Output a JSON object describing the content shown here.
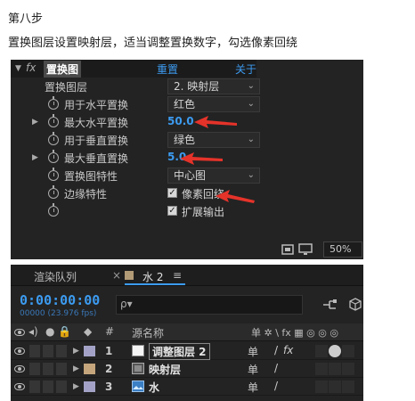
{
  "article": {
    "step_title": "第八步",
    "instruction": "置换图层设置映射层，适当调整置换数字，勾选像素回绕"
  },
  "effect_controls": {
    "effect": {
      "name": "置换图",
      "reset_label": "重置",
      "about_label": "关于"
    },
    "properties": [
      {
        "id": "map_layer",
        "label": "置换图层",
        "control": "dropdown",
        "value": "2. 映射层"
      },
      {
        "id": "use_horizontal",
        "label": "用于水平置换",
        "control": "dropdown",
        "value": "红色"
      },
      {
        "id": "max_horizontal",
        "label": "最大水平置换",
        "control": "number",
        "value": "50.0"
      },
      {
        "id": "use_vertical",
        "label": "用于垂直置换",
        "control": "dropdown",
        "value": "绿色"
      },
      {
        "id": "max_vertical",
        "label": "最大垂直置换",
        "control": "number",
        "value": "5.0"
      },
      {
        "id": "map_behavior",
        "label": "置换图特性",
        "control": "dropdown",
        "value": "中心图"
      },
      {
        "id": "edge_behavior",
        "label": "边缘特性",
        "control": "checkbox",
        "value": "像素回绕",
        "checked": true
      },
      {
        "id": "expand_output",
        "label": "",
        "control": "checkbox",
        "value": "扩展输出",
        "checked": true
      }
    ],
    "zoom": "50%"
  },
  "timeline": {
    "tabs": {
      "render_queue": "渲染队列",
      "comp_close": "×",
      "comp_name": "水 2",
      "menu": "≡"
    },
    "timecode": "0:00:00:00",
    "fps_label": "00000 (23.976 fps)",
    "search_glyph": "ρ▾",
    "columns": {
      "number": "#",
      "source_name": "源名称",
      "switches": "单 ✲ \\ fx ▦ ◎ ◎ ◎"
    },
    "layers": [
      {
        "number": "1",
        "name": "调整图层 2",
        "label_color": "#a3a2c6",
        "type": "adjustment"
      },
      {
        "number": "2",
        "name": "映射层",
        "label_color": "#c4a57c",
        "type": "precomp"
      },
      {
        "number": "3",
        "name": "水",
        "label_color": "#a3a2c6",
        "type": "footage"
      }
    ]
  },
  "colors": {
    "panel_bg": "#232323",
    "accent_blue": "#3c9bf0",
    "annotation_red": "#e5332a"
  }
}
